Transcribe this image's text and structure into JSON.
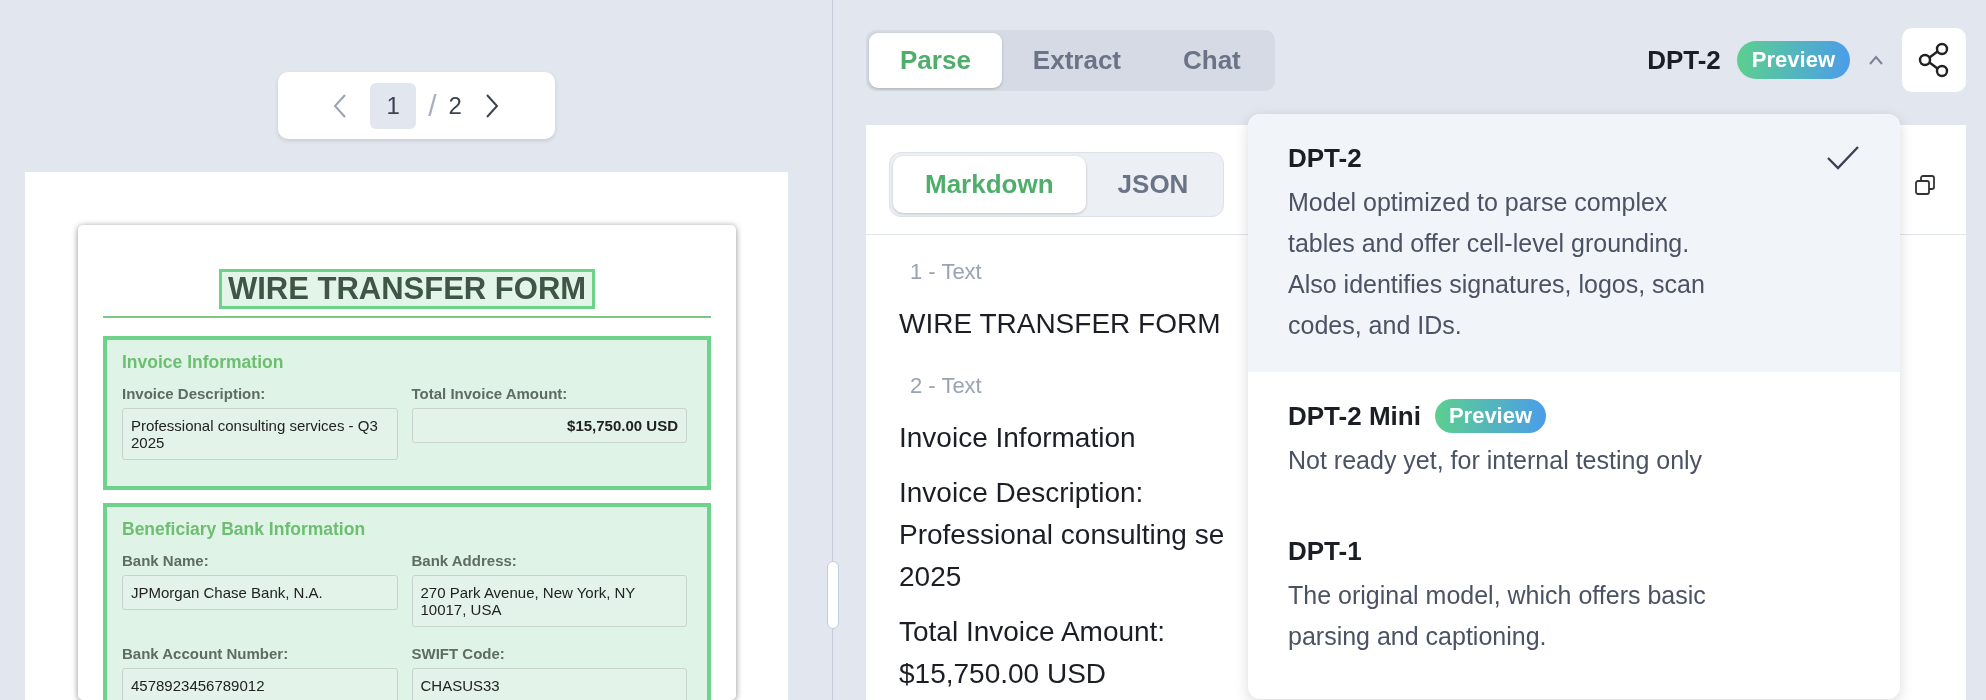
{
  "pager": {
    "current": "1",
    "separator": "/",
    "total": "2"
  },
  "document": {
    "title": "WIRE TRANSFER FORM",
    "sections": [
      {
        "heading": "Invoice Information",
        "fields": [
          {
            "label": "Invoice Description:",
            "value": "Professional consulting services - Q3 2025",
            "kind": "text"
          },
          {
            "label": "Total Invoice Amount:",
            "value": "$15,750.00 USD",
            "kind": "amount"
          }
        ]
      },
      {
        "heading": "Beneficiary Bank Information",
        "fields": [
          {
            "label": "Bank Name:",
            "value": "JPMorgan Chase Bank, N.A.",
            "kind": "text"
          },
          {
            "label": "Bank Address:",
            "value": "270 Park Avenue, New York, NY 10017, USA",
            "kind": "text"
          },
          {
            "label": "Bank Account Number:",
            "value": "4578923456789012",
            "kind": "text"
          },
          {
            "label": "SWIFT Code:",
            "value": "CHASUS33",
            "kind": "text"
          }
        ]
      }
    ]
  },
  "tabs": [
    {
      "label": "Parse",
      "selected": true
    },
    {
      "label": "Extract",
      "selected": false
    },
    {
      "label": "Chat",
      "selected": false
    }
  ],
  "model": {
    "name": "DPT-2",
    "badge": "Preview",
    "expanded": true
  },
  "view_tabs": [
    {
      "label": "Markdown",
      "selected": true
    },
    {
      "label": "JSON",
      "selected": false
    }
  ],
  "blocks": [
    {
      "label": "1 - Text",
      "lines": [
        "WIRE TRANSFER FORM"
      ]
    },
    {
      "label": "2 - Text",
      "lines": [
        "Invoice Information",
        "Invoice Description:",
        "Professional consulting se",
        "2025",
        "Total Invoice Amount:",
        "$15,750.00 USD"
      ]
    }
  ],
  "model_menu": [
    {
      "name": "DPT-2",
      "description": "Model optimized to parse complex tables and offer cell-level grounding. Also identifies signatures, logos, scan codes, and IDs.",
      "selected": true
    },
    {
      "name": "DPT-2 Mini",
      "badge": "Preview",
      "description": "Not ready yet, for internal testing only",
      "selected": false
    },
    {
      "name": "DPT-1",
      "description": "The original model, which offers basic parsing and captioning.",
      "selected": false
    }
  ]
}
